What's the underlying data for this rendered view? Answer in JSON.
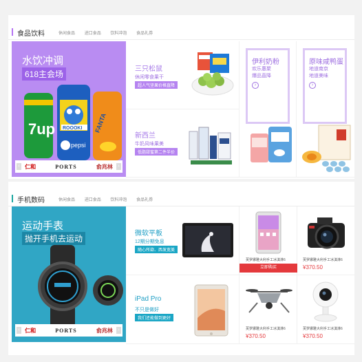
{
  "food": {
    "title": "食品饮料",
    "accent": "#b573f3",
    "nav": [
      "休闲食品",
      "进口食品",
      "饮料冲泡",
      "食品礼券"
    ],
    "banner": {
      "line1": "水饮冲调",
      "line2": "618主会场",
      "bg": "#b98cf2",
      "can1": "7up",
      "can2": "pepsi",
      "can3": "ROOOKI",
      "can4": "FANTA"
    },
    "brands": [
      "仁和",
      "PORTS",
      "俞兆林"
    ],
    "promo1": {
      "title": "三只松鼠",
      "sub": "休闲零食果干",
      "tag": "超人气坚果价格直降"
    },
    "promo2": {
      "title": "新西兰",
      "sub": "牛奶风味果美",
      "tag": "低脂甜蜜第二件半价"
    },
    "tall1": {
      "title": "伊利奶粉",
      "sub1": "欢乐惠聚",
      "sub2": "爆品直降",
      "arrow": "›"
    },
    "tall2": {
      "title": "原味咸鸭蛋",
      "sub1": "地道南京",
      "sub2": "地道美味",
      "arrow": "›"
    }
  },
  "digital": {
    "title": "手机数码",
    "accent": "#1aa6a0",
    "nav": [
      "休闲食品",
      "进口食品",
      "饮料冲泡",
      "食品礼券"
    ],
    "banner": {
      "line1": "运动手表",
      "line2": "抛开手机去运动",
      "bg": "#30a6c5"
    },
    "brands": [
      "仁和",
      "PORTS",
      "俞兆林"
    ],
    "promo1": {
      "title": "微软平板",
      "sub": "12期分期免息",
      "tag": "随心所欲、西发宽美"
    },
    "promo2": {
      "title": "iPad Pro",
      "sub": "不只是做好",
      "tag": "我们还能做到更好"
    },
    "products": [
      {
        "name": "芙罗娜雅大利手工冰淇淋6",
        "price": "",
        "buy": "立即购买"
      },
      {
        "name": "芙罗娜雅大利手工冰淇淋6",
        "price": "¥370.50"
      },
      {
        "name": "芙罗娜雅大利手工冰淇淋6",
        "price": "¥370.50"
      },
      {
        "name": "芙罗娜雅大利手工冰淇淋6",
        "price": "¥370.50"
      }
    ]
  }
}
